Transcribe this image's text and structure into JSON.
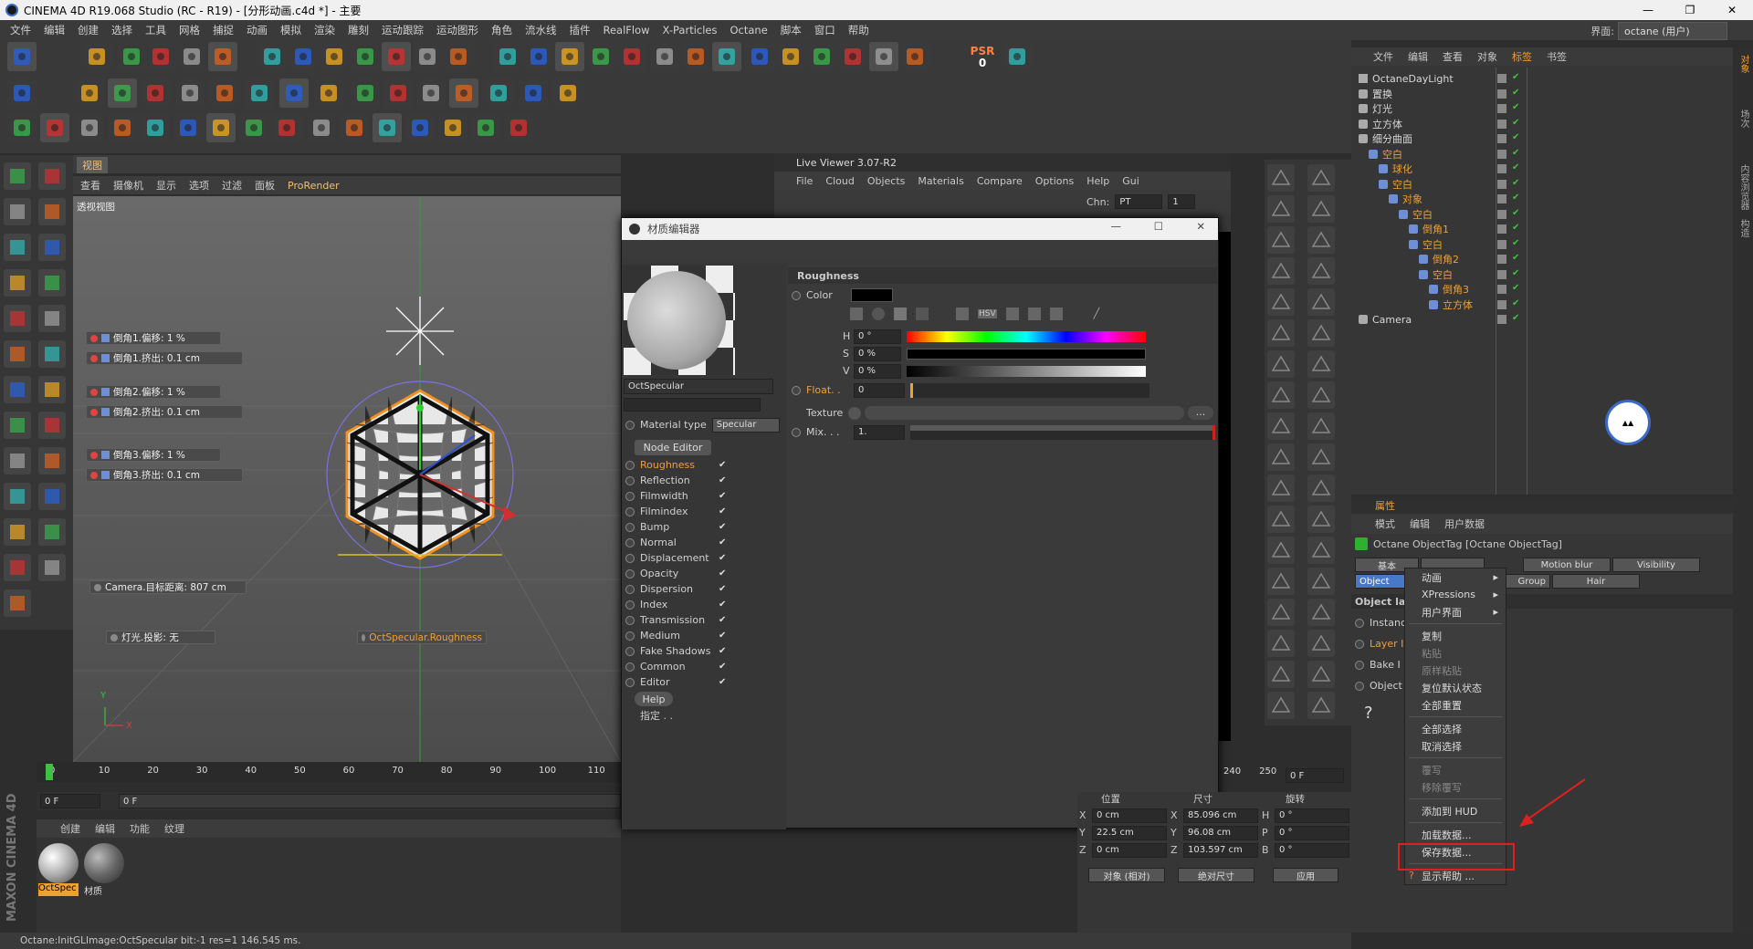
{
  "window": {
    "title": "CINEMA 4D R19.068 Studio (RC - R19) - [分形动画.c4d *] - 主要",
    "minimize": "—",
    "maximize": "❐",
    "close": "✕"
  },
  "menu": [
    "文件",
    "编辑",
    "创建",
    "选择",
    "工具",
    "网格",
    "捕捉",
    "动画",
    "模拟",
    "渲染",
    "雕刻",
    "运动跟踪",
    "运动图形",
    "角色",
    "流水线",
    "插件",
    "RealFlow",
    "X-Particles",
    "Octane",
    "脚本",
    "窗口",
    "帮助"
  ],
  "layout": {
    "label": "界面:",
    "value": "octane (用户)"
  },
  "viewport": {
    "tab": "视图",
    "menu": [
      "查看",
      "摄像机",
      "显示",
      "选项",
      "过滤",
      "面板",
      "ProRender"
    ],
    "view_name": "透视视图",
    "hud": [
      "倒角1.偏移:   1 %",
      "倒角1.挤出:   0.1 cm",
      "倒角2.偏移:   1 %",
      "倒角2.挤出:   0.1 cm",
      "倒角3.偏移:   1 %",
      "倒角3.挤出:   0.1 cm"
    ],
    "camera_hud": "Camera.目标距离:   807 cm",
    "light_hud": "灯光.投影: 无",
    "oct_hud": "OctSpecular.Roughness",
    "axis_y": "Y",
    "axis_x": "X"
  },
  "timeline": {
    "ticks": [
      "0",
      "10",
      "20",
      "30",
      "40",
      "50",
      "60",
      "70",
      "80",
      "90",
      "100",
      "110"
    ],
    "ticks_right": [
      "240",
      "250"
    ],
    "current_frame": "0 F",
    "frame_left": "0 F",
    "frame_left2": "0 F"
  },
  "material_manager": {
    "menu": [
      "创建",
      "编辑",
      "功能",
      "纹理"
    ],
    "items": [
      "OctSpec",
      "材质"
    ]
  },
  "status": "Octane:InitGLImage:OctSpecular  bit:-1 res=1  146.545 ms.",
  "live_viewer": {
    "title": "Live Viewer 3.07-R2",
    "menu": [
      "File",
      "Cloud",
      "Objects",
      "Materials",
      "Compare",
      "Options",
      "Help",
      "Gui"
    ],
    "chn_label": "Chn:",
    "chn_value": "PT",
    "chn_num": "1"
  },
  "mat_editor": {
    "title": "材质编辑器",
    "name": "OctSpecular",
    "material_type_label": "Material type",
    "material_type_value": "Specular",
    "node_editor": "Node Editor",
    "channels": [
      "Roughness",
      "Reflection",
      "Filmwidth",
      "Filmindex",
      "Bump",
      "Normal",
      "Displacement",
      "Opacity",
      "Dispersion",
      "Index",
      "Transmission",
      "Medium",
      "Fake Shadows",
      "Common",
      "Editor"
    ],
    "help": "Help",
    "assign": "指定 . .",
    "section": "Roughness",
    "color_label": "Color",
    "h_label": "H",
    "h_value": "0 °",
    "s_label": "S",
    "s_value": "0 %",
    "v_label": "V",
    "v_value": "0 %",
    "float_label": "Float. .",
    "float_value": "0",
    "texture_label": "Texture",
    "mix_label": "Mix. . .",
    "mix_value": "1.",
    "scale_ticks": [
      "0",
      "0.1",
      "0.2",
      "0.3",
      "0.4",
      "0.5",
      "0.6",
      "0.7",
      "0.8",
      "0.9",
      "1"
    ],
    "hsv_btn": "HSV"
  },
  "object_manager": {
    "menu": [
      "文件",
      "编辑",
      "查看",
      "对象",
      "标签",
      "书签"
    ],
    "tree": [
      {
        "label": "OctaneDayLight",
        "indent": 0
      },
      {
        "label": "置换",
        "indent": 0
      },
      {
        "label": "灯光",
        "indent": 0
      },
      {
        "label": "立方体",
        "indent": 0
      },
      {
        "label": "细分曲面",
        "indent": 0
      },
      {
        "label": "空白",
        "indent": 1
      },
      {
        "label": "球化",
        "indent": 2
      },
      {
        "label": "空白",
        "indent": 2
      },
      {
        "label": "对象",
        "indent": 3
      },
      {
        "label": "空白",
        "indent": 4
      },
      {
        "label": "倒角1",
        "indent": 5
      },
      {
        "label": "空白",
        "indent": 5
      },
      {
        "label": "倒角2",
        "indent": 6
      },
      {
        "label": "空白",
        "indent": 6
      },
      {
        "label": "倒角3",
        "indent": 7
      },
      {
        "label": "立方体",
        "indent": 7
      },
      {
        "label": "Camera",
        "indent": 0
      }
    ]
  },
  "attributes": {
    "header": "属性",
    "menu": [
      "模式",
      "编辑",
      "用户数据"
    ],
    "tag_title": "Octane ObjectTag [Octane ObjectTag]",
    "tabs_row1": [
      "基本",
      "",
      "Motion blur",
      "Visibility"
    ],
    "tabs_row2": [
      "Object",
      "Group",
      "Hair"
    ],
    "section": "Object layer",
    "props": [
      "Instance",
      "Layer I",
      "Bake I",
      "Object"
    ]
  },
  "context_menu": {
    "items": [
      {
        "label": "动画",
        "sub": true,
        "dis": false
      },
      {
        "label": "XPressions",
        "sub": true,
        "dis": false
      },
      {
        "label": "用户界面",
        "sub": true,
        "dis": false
      },
      {
        "sep": true
      },
      {
        "label": "复制",
        "dis": false
      },
      {
        "label": "粘贴",
        "dis": true
      },
      {
        "label": "原样粘贴",
        "dis": true
      },
      {
        "label": "复位默认状态",
        "dis": false
      },
      {
        "label": "全部重置",
        "dis": false
      },
      {
        "sep": true
      },
      {
        "label": "全部选择",
        "dis": false
      },
      {
        "label": "取消选择",
        "dis": false
      },
      {
        "sep": true
      },
      {
        "label": "覆写",
        "dis": true
      },
      {
        "label": "移除覆写",
        "dis": true
      },
      {
        "sep": true
      },
      {
        "label": "添加到 HUD",
        "dis": false,
        "hl": true
      },
      {
        "sep": true
      },
      {
        "label": "加载数据...",
        "dis": false
      },
      {
        "label": "保存数据...",
        "dis": false
      },
      {
        "sep": true
      },
      {
        "label": "显示帮助 ...",
        "dis": false
      }
    ]
  },
  "coords": {
    "headers": [
      "位置",
      "尺寸",
      "旋转"
    ],
    "rows": [
      {
        "a": "X",
        "av": "0 cm",
        "b": "X",
        "bv": "85.096 cm",
        "c": "H",
        "cv": "0 °"
      },
      {
        "a": "Y",
        "av": "22.5 cm",
        "b": "Y",
        "bv": "96.08 cm",
        "c": "P",
        "cv": "0 °"
      },
      {
        "a": "Z",
        "av": "0 cm",
        "b": "Z",
        "bv": "103.597 cm",
        "c": "B",
        "cv": "0 °"
      }
    ],
    "mode1": "对象 (相对)",
    "mode2": "绝对尺寸",
    "apply": "应用"
  },
  "psr": {
    "label": "PSR",
    "value": "0"
  },
  "right_tabs": [
    "对象",
    "场次",
    "内容浏览器",
    "构造"
  ],
  "logo_text": "MAXON CINEMA 4D",
  "colors": {
    "accent": "#f0a030",
    "highlight": "#e02020",
    "selected": "#4a78c8"
  }
}
